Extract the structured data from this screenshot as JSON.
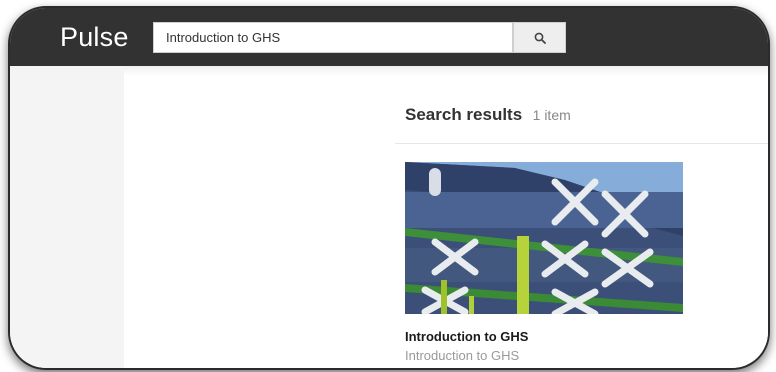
{
  "header": {
    "brand": "Pulse",
    "search": {
      "value": "Introduction to GHS",
      "button_icon": "search-icon"
    }
  },
  "results": {
    "title": "Search results",
    "count_text": "1 item",
    "items": [
      {
        "title": "Introduction to GHS",
        "subtitle": "Introduction to GHS",
        "image": "building-facade-photo"
      }
    ]
  },
  "colors": {
    "topbar": "#323232",
    "sidebar": "#f4f4f4",
    "sky": "#7ea6d9"
  }
}
